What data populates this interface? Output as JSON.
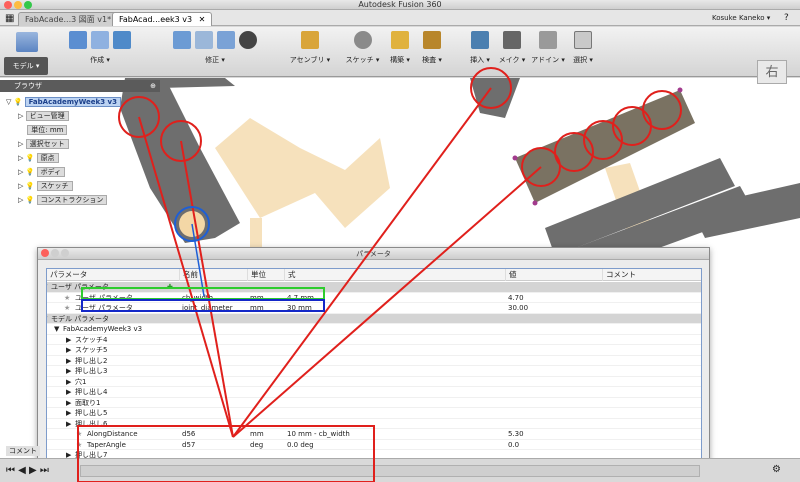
{
  "window": {
    "title": "Autodesk Fusion 360"
  },
  "tabs": [
    {
      "label": "FabAcade...3 図面 v1*"
    },
    {
      "label": "FabAcad...eek3 v3"
    }
  ],
  "user": {
    "name": "Kosuke Kaneko ▾"
  },
  "toolbar": {
    "workspace": "モデル ▾",
    "groups": [
      "作成 ▾",
      "修正 ▾",
      "アセンブリ ▾",
      "スケッチ ▾",
      "構築 ▾",
      "検査 ▾",
      "挿入 ▾",
      "メイク ▾",
      "アドイン ▾",
      "選択 ▾"
    ]
  },
  "viewcube": {
    "label": "右"
  },
  "browser": {
    "title": "ブラウザ",
    "items": [
      "FabAcademyWeek3 v3",
      "ビュー管理",
      "単位: mm",
      "選択セット",
      "原点",
      "ボディ",
      "スケッチ",
      "コンストラクション"
    ]
  },
  "dialog": {
    "title": "パラメータ",
    "columns": [
      "パラメータ",
      "名前",
      "単位",
      "式",
      "値",
      "コメント"
    ],
    "add_symbol": "✚",
    "rows": [
      {
        "label": "ユーザ パラメータ",
        "name": "",
        "unit": "",
        "expr": "",
        "value": "",
        "kind": "group",
        "indent": 0
      },
      {
        "label": "ユーザ パラメータ",
        "name": "cb_width",
        "unit": "mm",
        "expr": "4.7 mm",
        "value": "4.70",
        "kind": "param",
        "indent": 2
      },
      {
        "label": "ユーザ パラメータ",
        "name": "joint_diameter",
        "unit": "mm",
        "expr": "30 mm",
        "value": "30.00",
        "kind": "param",
        "indent": 2
      },
      {
        "label": "モデル パラメータ",
        "name": "",
        "unit": "",
        "expr": "",
        "value": "",
        "kind": "group",
        "indent": 0
      },
      {
        "label": "FabAcademyWeek3 v3",
        "name": "",
        "unit": "",
        "expr": "",
        "value": "",
        "kind": "sub",
        "indent": 1
      },
      {
        "label": "スケッチ4",
        "name": "",
        "unit": "",
        "expr": "",
        "value": "",
        "kind": "sub",
        "indent": 2
      },
      {
        "label": "スケッチ5",
        "name": "",
        "unit": "",
        "expr": "",
        "value": "",
        "kind": "sub",
        "indent": 2
      },
      {
        "label": "押し出し2",
        "name": "",
        "unit": "",
        "expr": "",
        "value": "",
        "kind": "sub",
        "indent": 2
      },
      {
        "label": "押し出し3",
        "name": "",
        "unit": "",
        "expr": "",
        "value": "",
        "kind": "sub",
        "indent": 2
      },
      {
        "label": "穴1",
        "name": "",
        "unit": "",
        "expr": "",
        "value": "",
        "kind": "sub",
        "indent": 2
      },
      {
        "label": "押し出し4",
        "name": "",
        "unit": "",
        "expr": "",
        "value": "",
        "kind": "sub",
        "indent": 2
      },
      {
        "label": "面取り1",
        "name": "",
        "unit": "",
        "expr": "",
        "value": "",
        "kind": "sub",
        "indent": 2
      },
      {
        "label": "押し出し5",
        "name": "",
        "unit": "",
        "expr": "",
        "value": "",
        "kind": "sub",
        "indent": 2
      },
      {
        "label": "押し出し6",
        "name": "",
        "unit": "",
        "expr": "",
        "value": "",
        "kind": "sub",
        "indent": 2
      },
      {
        "label": "AlongDistance",
        "name": "d56",
        "unit": "mm",
        "expr": "10 mm - cb_width",
        "value": "5.30",
        "kind": "param",
        "indent": 3
      },
      {
        "label": "TaperAngle",
        "name": "d57",
        "unit": "deg",
        "expr": "0.0 deg",
        "value": "0.0",
        "kind": "param",
        "indent": 3
      },
      {
        "label": "押し出し7",
        "name": "",
        "unit": "",
        "expr": "",
        "value": "",
        "kind": "sub",
        "indent": 2
      }
    ]
  },
  "comments": {
    "label": "コメント"
  },
  "colors": {
    "accent": "#2b6fd6",
    "annotation_red": "#e0201c",
    "annotation_green": "#2ecc2e",
    "annotation_blue": "#1428c8",
    "part_fill": "#6e6e6e",
    "ghost_fill": "#f3d7a6"
  }
}
